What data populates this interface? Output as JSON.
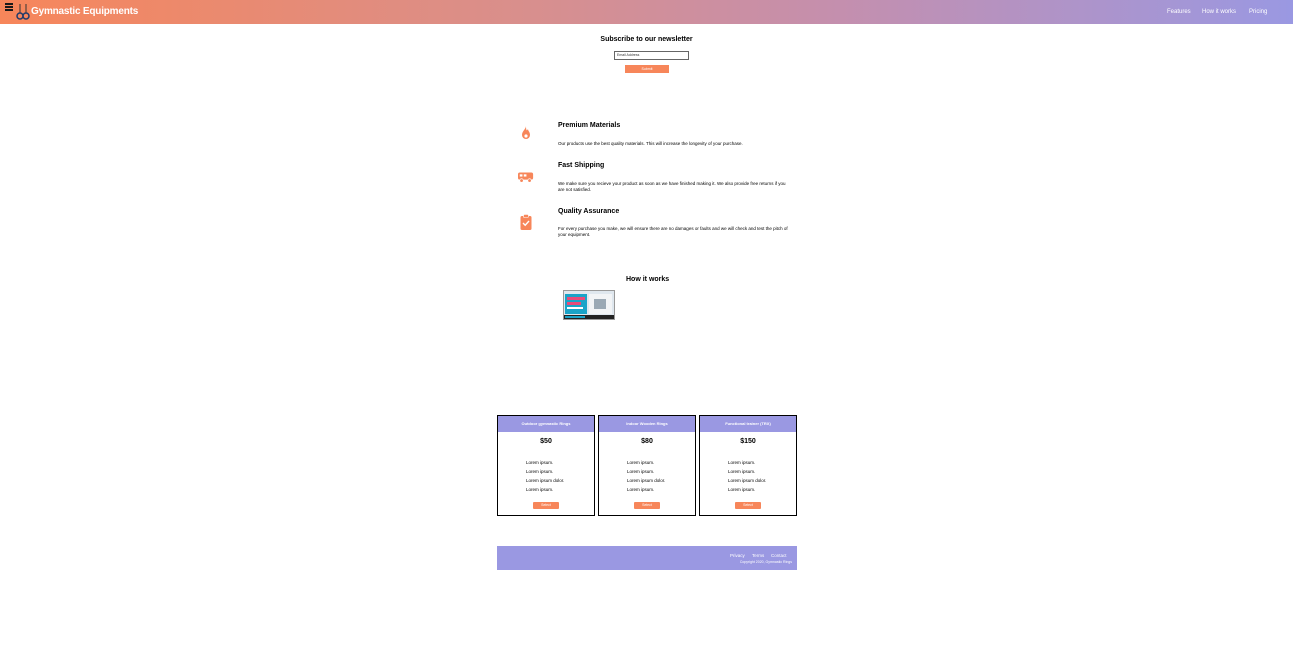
{
  "header": {
    "brand": "Gymnastic Equipments",
    "nav": [
      "Features",
      "How it works",
      "Pricing"
    ]
  },
  "newsletter": {
    "title": "Subscribe to our newsletter",
    "email_placeholder": "Email Address",
    "submit_label": "Submit"
  },
  "features": [
    {
      "icon": "fire-icon",
      "title": "Premium Materials",
      "text": "Our products use the best quality materials. This will increase the longevity of your purchase."
    },
    {
      "icon": "truck-icon",
      "title": "Fast Shipping",
      "text": "We make sure you recieve your product as soon as we have finished making it. We also provide free returns if you are not satisfied."
    },
    {
      "icon": "clipboard-check-icon",
      "title": "Quality Assurance",
      "text": "For every purchase you make, we will ensure there are no damages or faults and we will check and test the pitch of your equipment."
    }
  ],
  "how_it_works": {
    "title": "How it works"
  },
  "pricing": [
    {
      "name": "Outdoor gymnastic Rings",
      "price": "$50",
      "items": [
        "Lorem ipsum.",
        "Lorem ipsum.",
        "Lorem ipsum dolor.",
        "Lorem ipsum."
      ],
      "button": "Select"
    },
    {
      "name": "Indoor Wooden Rings",
      "price": "$80",
      "items": [
        "Lorem ipsum.",
        "Lorem ipsum.",
        "Lorem ipsum dolor.",
        "Lorem ipsum."
      ],
      "button": "Select"
    },
    {
      "name": "Functional trainer (TRX)",
      "price": "$150",
      "items": [
        "Lorem ipsum.",
        "Lorem ipsum.",
        "Lorem ipsum dolor.",
        "Lorem ipsum."
      ],
      "button": "Select"
    }
  ],
  "footer": {
    "links": [
      "Privacy",
      "Terms",
      "Contact"
    ],
    "copyright": "Copyright 2020, Gymnastic Rings"
  },
  "colors": {
    "accent": "#f7865a",
    "secondary": "#9a98e2"
  }
}
